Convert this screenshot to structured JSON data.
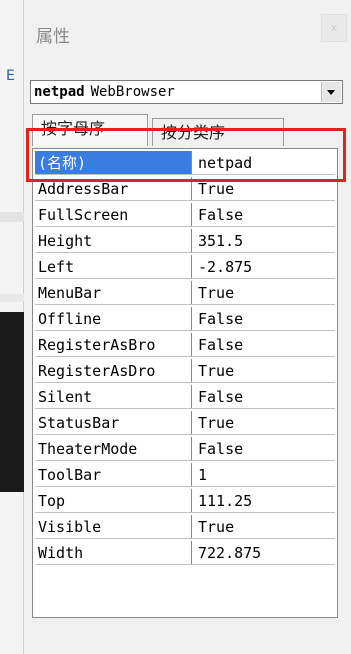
{
  "panel": {
    "title": "属性",
    "close_label": "x"
  },
  "object_selector": {
    "name": "netpad",
    "type": "WebBrowser"
  },
  "tabs": [
    {
      "label": "按字母序",
      "active": true
    },
    {
      "label": "按分类序",
      "active": false
    }
  ],
  "properties": [
    {
      "name": "(名称)",
      "value": "netpad"
    },
    {
      "name": "AddressBar",
      "value": "True"
    },
    {
      "name": "FullScreen",
      "value": "False"
    },
    {
      "name": "Height",
      "value": "351.5"
    },
    {
      "name": "Left",
      "value": "-2.875"
    },
    {
      "name": "MenuBar",
      "value": "True"
    },
    {
      "name": "Offline",
      "value": "False"
    },
    {
      "name": "RegisterAsBro",
      "value": "False"
    },
    {
      "name": "RegisterAsDro",
      "value": "True"
    },
    {
      "name": "Silent",
      "value": "False"
    },
    {
      "name": "StatusBar",
      "value": "True"
    },
    {
      "name": "TheaterMode",
      "value": "False"
    },
    {
      "name": "ToolBar",
      "value": "1"
    },
    {
      "name": "Top",
      "value": "111.25"
    },
    {
      "name": "Visible",
      "value": "True"
    },
    {
      "name": "Width",
      "value": "722.875"
    }
  ],
  "highlight_color": "#e52020",
  "selection_color": "#3a7de0"
}
